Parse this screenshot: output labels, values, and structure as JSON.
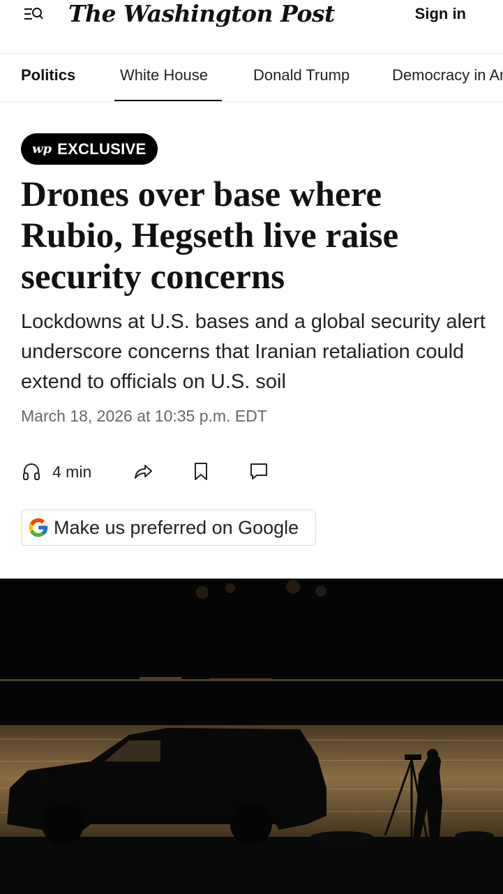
{
  "header": {
    "logo": "The Washington Post",
    "sign_in": "Sign in"
  },
  "nav": {
    "items": [
      "Politics",
      "White House",
      "Donald Trump",
      "Democracy in America"
    ],
    "active_index": 1
  },
  "article": {
    "badge_mark": "wp",
    "badge_label": "EXCLUSIVE",
    "headline": "Drones over base where Rubio, Hegseth live raise security concerns",
    "dek": "Lockdowns at U.S. bases and a global security alert underscore concerns that Iranian retaliation could extend to officials on U.S. soil",
    "timestamp": "March 18, 2026 at 10:35 p.m. EDT",
    "listen_duration": "4 min"
  },
  "actions": {
    "icons": [
      "headphones-icon",
      "share-icon",
      "bookmark-icon",
      "comment-icon"
    ]
  },
  "google_preferred": {
    "label": "Make us preferred on Google"
  },
  "colors": {
    "text": "#111111",
    "muted": "#666666",
    "badge_bg": "#000000"
  }
}
